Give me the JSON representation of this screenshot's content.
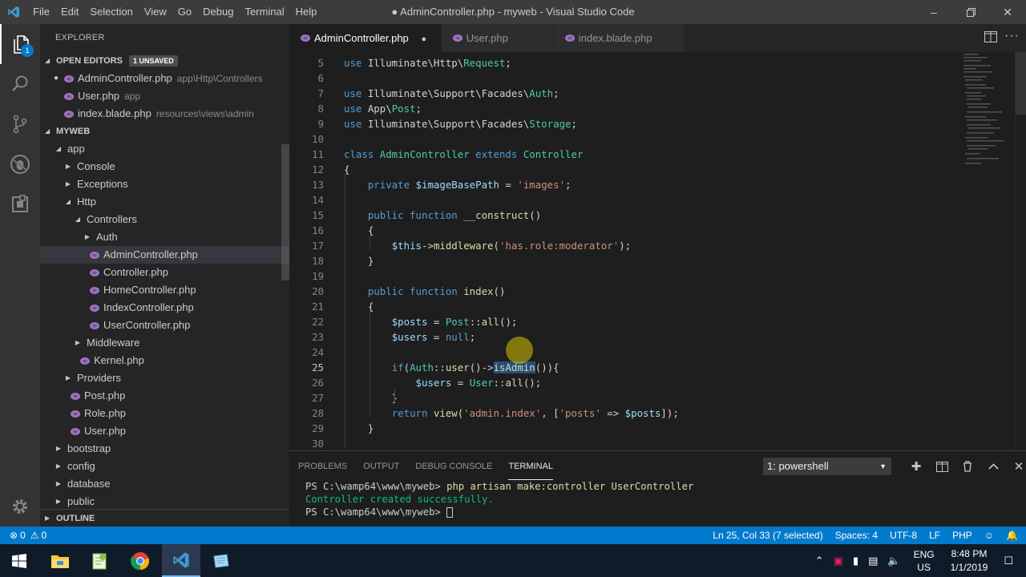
{
  "window": {
    "title": "● AdminController.php - myweb - Visual Studio Code",
    "menu": [
      "File",
      "Edit",
      "Selection",
      "View",
      "Go",
      "Debug",
      "Terminal",
      "Help"
    ]
  },
  "activity_bar": {
    "items": [
      "files-icon",
      "search-icon",
      "source-control-icon",
      "debug-icon",
      "extensions-icon"
    ],
    "explorer_badge": "1"
  },
  "sidebar": {
    "title": "EXPLORER",
    "open_editors": {
      "header": "OPEN EDITORS",
      "badge": "1 UNSAVED",
      "items": [
        {
          "name": "AdminController.php",
          "desc": "app\\Http\\Controllers",
          "dirty": true
        },
        {
          "name": "User.php",
          "desc": "app",
          "dirty": false
        },
        {
          "name": "index.blade.php",
          "desc": "resources\\views\\admin",
          "dirty": false
        }
      ]
    },
    "project": {
      "header": "MYWEB",
      "tree": [
        {
          "label": "app",
          "depth": 0,
          "kind": "folder",
          "expanded": true
        },
        {
          "label": "Console",
          "depth": 1,
          "kind": "folder",
          "expanded": false
        },
        {
          "label": "Exceptions",
          "depth": 1,
          "kind": "folder",
          "expanded": false
        },
        {
          "label": "Http",
          "depth": 1,
          "kind": "folder",
          "expanded": true
        },
        {
          "label": "Controllers",
          "depth": 2,
          "kind": "folder",
          "expanded": true
        },
        {
          "label": "Auth",
          "depth": 3,
          "kind": "folder",
          "expanded": false
        },
        {
          "label": "AdminController.php",
          "depth": 3,
          "kind": "php",
          "selected": true
        },
        {
          "label": "Controller.php",
          "depth": 3,
          "kind": "php"
        },
        {
          "label": "HomeController.php",
          "depth": 3,
          "kind": "php"
        },
        {
          "label": "IndexController.php",
          "depth": 3,
          "kind": "php"
        },
        {
          "label": "UserController.php",
          "depth": 3,
          "kind": "php"
        },
        {
          "label": "Middleware",
          "depth": 2,
          "kind": "folder",
          "expanded": false
        },
        {
          "label": "Kernel.php",
          "depth": 2,
          "kind": "php"
        },
        {
          "label": "Providers",
          "depth": 1,
          "kind": "folder",
          "expanded": false
        },
        {
          "label": "Post.php",
          "depth": 1,
          "kind": "php"
        },
        {
          "label": "Role.php",
          "depth": 1,
          "kind": "php"
        },
        {
          "label": "User.php",
          "depth": 1,
          "kind": "php"
        },
        {
          "label": "bootstrap",
          "depth": 0,
          "kind": "folder",
          "expanded": false
        },
        {
          "label": "config",
          "depth": 0,
          "kind": "folder",
          "expanded": false
        },
        {
          "label": "database",
          "depth": 0,
          "kind": "folder",
          "expanded": false
        },
        {
          "label": "public",
          "depth": 0,
          "kind": "folder",
          "expanded": false
        }
      ]
    },
    "outline_header": "OUTLINE"
  },
  "tabs": [
    {
      "label": "AdminController.php",
      "active": true,
      "dirty": true
    },
    {
      "label": "User.php",
      "active": false,
      "dirty": false
    },
    {
      "label": "index.blade.php",
      "active": false,
      "dirty": false
    }
  ],
  "editor": {
    "current_line": 25,
    "lines": [
      {
        "n": "5",
        "tokens": [
          [
            "kw",
            "use "
          ],
          [
            "pl",
            "Illuminate\\Http\\"
          ],
          [
            "ty",
            "Request"
          ],
          [
            "pl",
            ";"
          ]
        ]
      },
      {
        "n": "6",
        "tokens": []
      },
      {
        "n": "7",
        "tokens": [
          [
            "kw",
            "use "
          ],
          [
            "pl",
            "Illuminate\\Support\\Facades\\"
          ],
          [
            "ty",
            "Auth"
          ],
          [
            "pl",
            ";"
          ]
        ]
      },
      {
        "n": "8",
        "tokens": [
          [
            "kw",
            "use "
          ],
          [
            "pl",
            "App\\"
          ],
          [
            "ty",
            "Post"
          ],
          [
            "pl",
            ";"
          ]
        ]
      },
      {
        "n": "9",
        "tokens": [
          [
            "kw",
            "use "
          ],
          [
            "pl",
            "Illuminate\\Support\\Facades\\"
          ],
          [
            "ty",
            "Storage"
          ],
          [
            "pl",
            ";"
          ]
        ]
      },
      {
        "n": "10",
        "tokens": []
      },
      {
        "n": "11",
        "tokens": [
          [
            "kw",
            "class "
          ],
          [
            "ty",
            "AdminController "
          ],
          [
            "kw",
            "extends "
          ],
          [
            "ty",
            "Controller"
          ]
        ]
      },
      {
        "n": "12",
        "tokens": [
          [
            "pl",
            "{"
          ]
        ]
      },
      {
        "n": "13",
        "tokens": [
          [
            "pl",
            "    "
          ],
          [
            "kw",
            "private "
          ],
          [
            "var",
            "$imageBasePath"
          ],
          [
            "pl",
            " = "
          ],
          [
            "str",
            "'images'"
          ],
          [
            "pl",
            ";"
          ]
        ]
      },
      {
        "n": "14",
        "tokens": []
      },
      {
        "n": "15",
        "tokens": [
          [
            "pl",
            "    "
          ],
          [
            "kw",
            "public function "
          ],
          [
            "fn",
            "__construct"
          ],
          [
            "pl",
            "()"
          ]
        ]
      },
      {
        "n": "16",
        "tokens": [
          [
            "pl",
            "    {"
          ]
        ]
      },
      {
        "n": "17",
        "tokens": [
          [
            "pl",
            "        "
          ],
          [
            "var",
            "$this"
          ],
          [
            "pl",
            "->"
          ],
          [
            "fn",
            "middleware"
          ],
          [
            "pl",
            "("
          ],
          [
            "str",
            "'has.role:moderator'"
          ],
          [
            "pl",
            ");"
          ]
        ]
      },
      {
        "n": "18",
        "tokens": [
          [
            "pl",
            "    }"
          ]
        ]
      },
      {
        "n": "19",
        "tokens": []
      },
      {
        "n": "20",
        "tokens": [
          [
            "pl",
            "    "
          ],
          [
            "kw",
            "public function "
          ],
          [
            "fn",
            "index"
          ],
          [
            "pl",
            "()"
          ]
        ]
      },
      {
        "n": "21",
        "tokens": [
          [
            "pl",
            "    {"
          ]
        ]
      },
      {
        "n": "22",
        "tokens": [
          [
            "pl",
            "        "
          ],
          [
            "var",
            "$posts"
          ],
          [
            "pl",
            " = "
          ],
          [
            "ty",
            "Post"
          ],
          [
            "pl",
            "::"
          ],
          [
            "fn",
            "all"
          ],
          [
            "pl",
            "();"
          ]
        ]
      },
      {
        "n": "23",
        "tokens": [
          [
            "pl",
            "        "
          ],
          [
            "var",
            "$users"
          ],
          [
            "pl",
            " = "
          ],
          [
            "kw",
            "null"
          ],
          [
            "pl",
            ";"
          ]
        ]
      },
      {
        "n": "24",
        "tokens": []
      },
      {
        "n": "25",
        "tokens": [
          [
            "pl",
            "        "
          ],
          [
            "kw",
            "if"
          ],
          [
            "pl",
            "("
          ],
          [
            "ty",
            "Auth"
          ],
          [
            "pl",
            "::"
          ],
          [
            "fn",
            "user"
          ],
          [
            "pl",
            "()->"
          ],
          [
            "fnhl",
            "isAdmin"
          ],
          [
            "pl",
            "()){"
          ]
        ]
      },
      {
        "n": "26",
        "tokens": [
          [
            "pl",
            "            "
          ],
          [
            "var",
            "$users"
          ],
          [
            "pl",
            " = "
          ],
          [
            "ty",
            "User"
          ],
          [
            "pl",
            "::"
          ],
          [
            "fn",
            "all"
          ],
          [
            "pl",
            "();"
          ]
        ]
      },
      {
        "n": "27",
        "tokens": [
          [
            "pl",
            "        }"
          ]
        ]
      },
      {
        "n": "28",
        "tokens": [
          [
            "pl",
            "        "
          ],
          [
            "kw",
            "return "
          ],
          [
            "fn",
            "view"
          ],
          [
            "pl",
            "("
          ],
          [
            "str",
            "'admin.index'"
          ],
          [
            "pl",
            ", ["
          ],
          [
            "str",
            "'posts'"
          ],
          [
            "pl",
            " => "
          ],
          [
            "var",
            "$posts"
          ],
          [
            "pl",
            "]);"
          ]
        ]
      },
      {
        "n": "29",
        "tokens": [
          [
            "pl",
            "    }"
          ]
        ]
      },
      {
        "n": "30",
        "tokens": []
      }
    ]
  },
  "panel": {
    "tabs": [
      "PROBLEMS",
      "OUTPUT",
      "DEBUG CONSOLE",
      "TERMINAL"
    ],
    "active_tab": "TERMINAL",
    "terminal_select": "1: powershell",
    "terminal_lines": [
      {
        "prompt": "PS C:\\wamp64\\www\\myweb> ",
        "cmd": "php artisan make:controller UserController"
      },
      {
        "output": "Controller created successfully."
      },
      {
        "prompt": "PS C:\\wamp64\\www\\myweb> ",
        "cmd": ""
      }
    ]
  },
  "statusbar": {
    "errors": "0",
    "warnings": "0",
    "position": "Ln 25, Col 33 (7 selected)",
    "spaces": "Spaces: 4",
    "encoding": "UTF-8",
    "eol": "LF",
    "language": "PHP"
  },
  "taskbar": {
    "lang_top": "ENG",
    "lang_bottom": "US",
    "time": "8:48 PM",
    "date": "1/1/2019"
  },
  "colors": {
    "accent": "#007acc",
    "php_icon": "#a074c4"
  }
}
